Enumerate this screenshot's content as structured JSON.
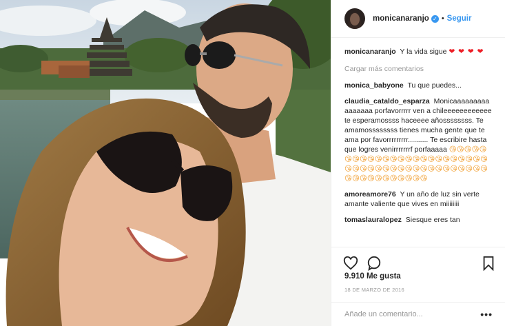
{
  "post": {
    "photo_alt": "Foto de monicanaranjo"
  },
  "header": {
    "username": "monicanaranjo",
    "verified_icon": "check",
    "separator": "•",
    "follow_label": "Seguir"
  },
  "caption": {
    "username": "monicanaranjo",
    "text": "Y la vida sigue",
    "hearts": "❤ ❤ ❤ ❤"
  },
  "load_more": "Cargar más comentarios",
  "comments": [
    {
      "user": "monica_babyone",
      "text": "Tu que puedes..."
    },
    {
      "user": "claudia_cataldo_esparza",
      "text": "Monicaaaaaaaaa aaaaaaa porfavorrrrr ven a chileeeeeeeeeeee te esperamossss haceeee añossssssss. Te amamossssssss tienes mucha gente que te ama por favorrrrrrrrr.......... Te escribire hasta que logres venirrrrrrrf porfaaaaa",
      "emojis": "😘😘😘😘😘😘😘😘😘😘😘😘😘😘😘😘😘😘😘😘😘😘😘😘😘😘😘😘😘😘😘😘😘😘😘😘😘😘😘😘😘😘😘😘😘😘😘😘😘😘😘😘😘😘"
    },
    {
      "user": "amoreamore76",
      "text": "Y un año de luz sin verte amante valiente que vives en miiiiiiii"
    },
    {
      "user": "tomaslauralopez",
      "text": "Siesque eres tan"
    }
  ],
  "actions": {
    "like_icon": "heart-outline",
    "comment_icon": "speech-bubble",
    "save_icon": "bookmark"
  },
  "likes": "9.910 Me gusta",
  "date": "18 DE MARZO DE 2016",
  "add_comment": {
    "placeholder": "Añade un comentario...",
    "more_label": "•••"
  },
  "colors": {
    "link": "#3897f0",
    "heart": "#ed1c24",
    "muted": "#999999",
    "border": "#efefef"
  }
}
